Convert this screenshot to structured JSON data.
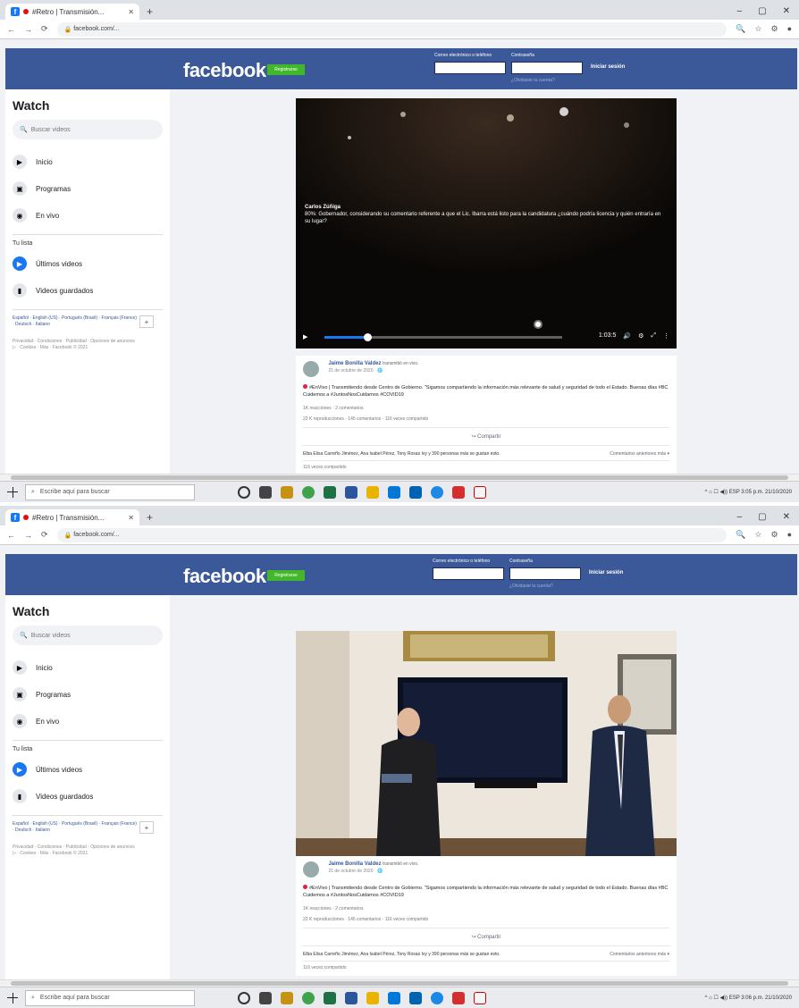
{
  "browser": {
    "tab_title": "#Retro | Transmisión...",
    "tab_close": "✕",
    "new_tab": "+",
    "url_1": "facebook.com/...",
    "url_2": "facebook.com/...",
    "window_controls": [
      "–",
      "▢",
      "✕"
    ]
  },
  "fb": {
    "logo": "facebook",
    "register": "Registrarse",
    "email_label": "Correo electrónico o teléfono",
    "password_label": "Contraseña",
    "forgot": "¿Olvidaste tu cuenta?",
    "login": "Iniciar sesión"
  },
  "sidebar": {
    "title": "Watch",
    "search_placeholder": "Buscar videos",
    "items": [
      {
        "label": "Inicio",
        "icon": "home-icon"
      },
      {
        "label": "Programas",
        "icon": "shows-icon"
      },
      {
        "label": "En vivo",
        "icon": "live-icon"
      }
    ],
    "your_list": "Tu lista",
    "list_items": [
      {
        "label": "Últimos videos",
        "icon": "latest-videos-icon"
      },
      {
        "label": "Videos guardados",
        "icon": "saved-videos-icon"
      }
    ],
    "languages": "Español · English (US) · Português (Brasil) · Français (France) · Deutsch · Italiano",
    "plus": "+",
    "footer": "Privacidad · Condiciones · Publicidad · Opciones de anuncios ▷ · Cookies · Más · Facebook © 2021"
  },
  "video1": {
    "overlay_name": "Carlos Zúñiga",
    "overlay_text": "80%: Gobernador, considerando su comentario referente a que el Lic. Ibarra está listo para la candidatura ¿cuándo podría licencia y quién entraría en su lugar?",
    "time": "1:03:5",
    "progress_pct": 0.18,
    "live_pos_pct": 0.9
  },
  "post": {
    "author": "Jaime Bonilla Valdez",
    "author_extra": "transmitió en vivo.",
    "date_1": "21 de octubre de 2020 · 🌐",
    "date_2": "21 de octubre de 2020 · 🌐",
    "text": "#EnVivo | Transmitiendo desde Centro de Gobierno. \"Sigamos compartiendo la información más relevante de salud y seguridad de todo el Estado. Buenas días #BC Cuidemos a #JuntosNosCuidamos #COVID19",
    "reactions": "1K reacciones · 2 comentarios",
    "counts": "22 K reproducciones · 145 comentarios · 116 veces compartido",
    "share": "Compartir",
    "comment_names": "Elba Elisa Carreño Jiménez, Ana Isabel Pérez, Tony Rosas Ivy y 390 personas más se gustan esto.",
    "comment_more": "Comentarios anteriores más ▾",
    "shares": "116 veces compartido"
  },
  "taskbar": {
    "search": "Escribe aquí para buscar",
    "tray_1": "^ ⌂ ☐ ◀)) ESP  3:05 p.m.  21/10/2020",
    "tray_2": "^ ⌂ ☐ ◀)) ESP  3:06 p.m.  21/10/2020"
  }
}
